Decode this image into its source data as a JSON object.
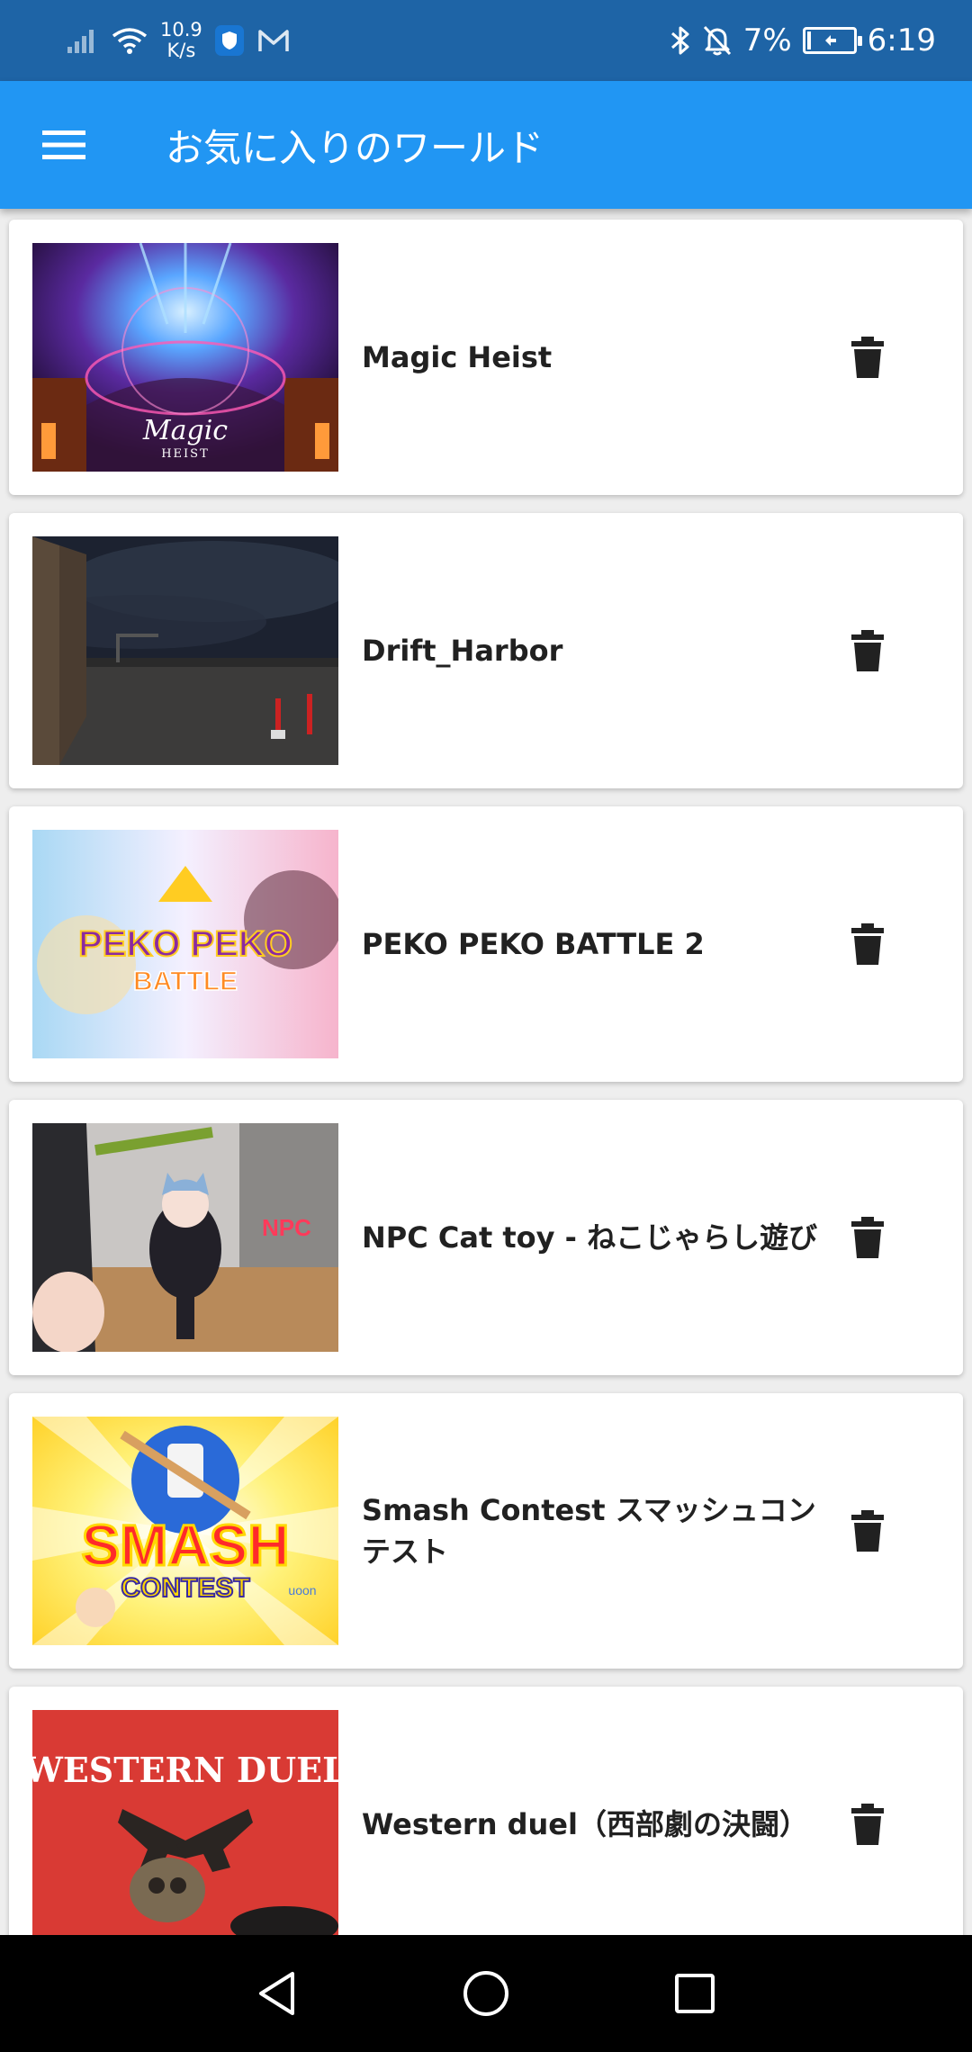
{
  "status_bar": {
    "net_speed_value": "10.9",
    "net_speed_unit": "K/s",
    "battery_percent": "7%",
    "battery_level": 0.07,
    "time": "6:19",
    "icons": [
      "signal-icon",
      "wifi-icon",
      "shield-app-icon",
      "mail-icon",
      "bluetooth-icon",
      "mute-icon",
      "battery-icon"
    ]
  },
  "app_bar": {
    "title": "お気に入りのワールド",
    "menu_icon": "menu-icon",
    "color": "#2196f3"
  },
  "worlds": [
    {
      "title": "Magic Heist",
      "thumb": "magic-heist-thumbnail",
      "delete_icon": "trash-icon"
    },
    {
      "title": "Drift_Harbor",
      "thumb": "drift-harbor-thumbnail",
      "delete_icon": "trash-icon"
    },
    {
      "title": "PEKO PEKO BATTLE 2",
      "thumb": "peko-peko-battle-thumbnail",
      "delete_icon": "trash-icon"
    },
    {
      "title": "NPC Cat toy - ねこじゃらし遊び",
      "thumb": "npc-cat-toy-thumbnail",
      "delete_icon": "trash-icon"
    },
    {
      "title": "Smash Contest スマッシュコンテスト",
      "thumb": "smash-contest-thumbnail",
      "delete_icon": "trash-icon"
    },
    {
      "title": "Western duel（西部劇の決闘）",
      "thumb": "western-duel-thumbnail",
      "delete_icon": "trash-icon"
    }
  ],
  "thumb_text": {
    "magic_top": "Magic",
    "magic_bottom": "HEIST",
    "peko_line1": "PEKO PEKO",
    "peko_line2": "BATTLE",
    "npc": "NPC",
    "smash_line1": "SMASH",
    "smash_line2": "CONTEST",
    "smash_credit": "uoon",
    "western": "WESTERN DUEL"
  },
  "nav_bar": {
    "back_icon": "back-triangle-icon",
    "home_icon": "home-circle-icon",
    "recents_icon": "recents-square-icon"
  }
}
